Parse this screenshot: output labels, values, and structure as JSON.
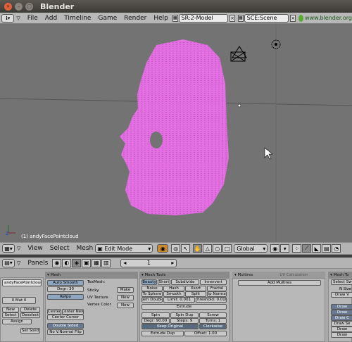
{
  "window": {
    "title": "Blender"
  },
  "menu": {
    "items": [
      "File",
      "Add",
      "Timeline",
      "Game",
      "Render",
      "Help"
    ],
    "screen": "SR:2-Model",
    "scene": "SCE:Scene",
    "url": "www.blender.org"
  },
  "viewport": {
    "object_label": "(1) andyFacePointcloud",
    "mesh_color": "#e36fe3",
    "background": "#737373"
  },
  "view3d_header": {
    "menus": [
      "View",
      "Select",
      "Mesh"
    ],
    "mode": "Edit Mode",
    "orientation": "Global"
  },
  "buttons_header": {
    "panels": "Panels",
    "frame": "1"
  },
  "link_panel": {
    "name": "andyFacePointcloud",
    "mat": "0 Mat 0",
    "new": "New",
    "delete": "Delete",
    "select": "Select",
    "deselect": "Deselect",
    "assign": "Assign",
    "set_solid": "Set Solid"
  },
  "mesh_panel": {
    "title": "Mesh",
    "auto_smooth": "Auto Smooth",
    "degr": "Degr: 30",
    "refpo": "Refpo",
    "texmesh": "TexMesh:",
    "sticky": "Sticky",
    "make": "Make",
    "uv_texture": "UV Texture",
    "new1": "New",
    "vertex_color": "Vertex Color",
    "new2": "New",
    "center": "Center",
    "center_new": "Center New",
    "center_cursor": "Center Cursor",
    "double_sided": "Double Sided",
    "no_vnormal_flip": "No V.Normal Flip"
  },
  "mesh_tools": {
    "title": "Mesh Tools",
    "r1": [
      "Beauty",
      "Short",
      "Subdivide",
      "Innervert"
    ],
    "r2": [
      "Noise",
      "Hash",
      "Xsort",
      "Fractal"
    ],
    "r3": [
      "To Sphere",
      "Smooth",
      "Split",
      "Flip Normals"
    ],
    "r4": [
      "Rem Double",
      "Limit: 0.001",
      "Threshold: 0.010"
    ],
    "extrude": "Extrude",
    "r5": [
      "Spin",
      "Spin Dup",
      "Screw"
    ],
    "r6": [
      "Degr: 90.00",
      "Steps: 9",
      "Turns: 1"
    ],
    "keep_original": "Keep Original",
    "clockwise": "Clockwise",
    "extrude_dup": "Extrude Dup",
    "offset": "Offset: 1.00"
  },
  "multires": {
    "title": "Multires",
    "tab2": "UV Calculation",
    "add": "Add Multires"
  },
  "mesh_tools_more": {
    "title": "Mesh To",
    "select_sw": "Select Sw",
    "nsize": "N Size",
    "draw_v": "Draw V",
    "draw_items": [
      "Draw",
      "Draw",
      "Draw C",
      "Draw Se",
      "Draw",
      "Draw",
      "Draw"
    ]
  }
}
